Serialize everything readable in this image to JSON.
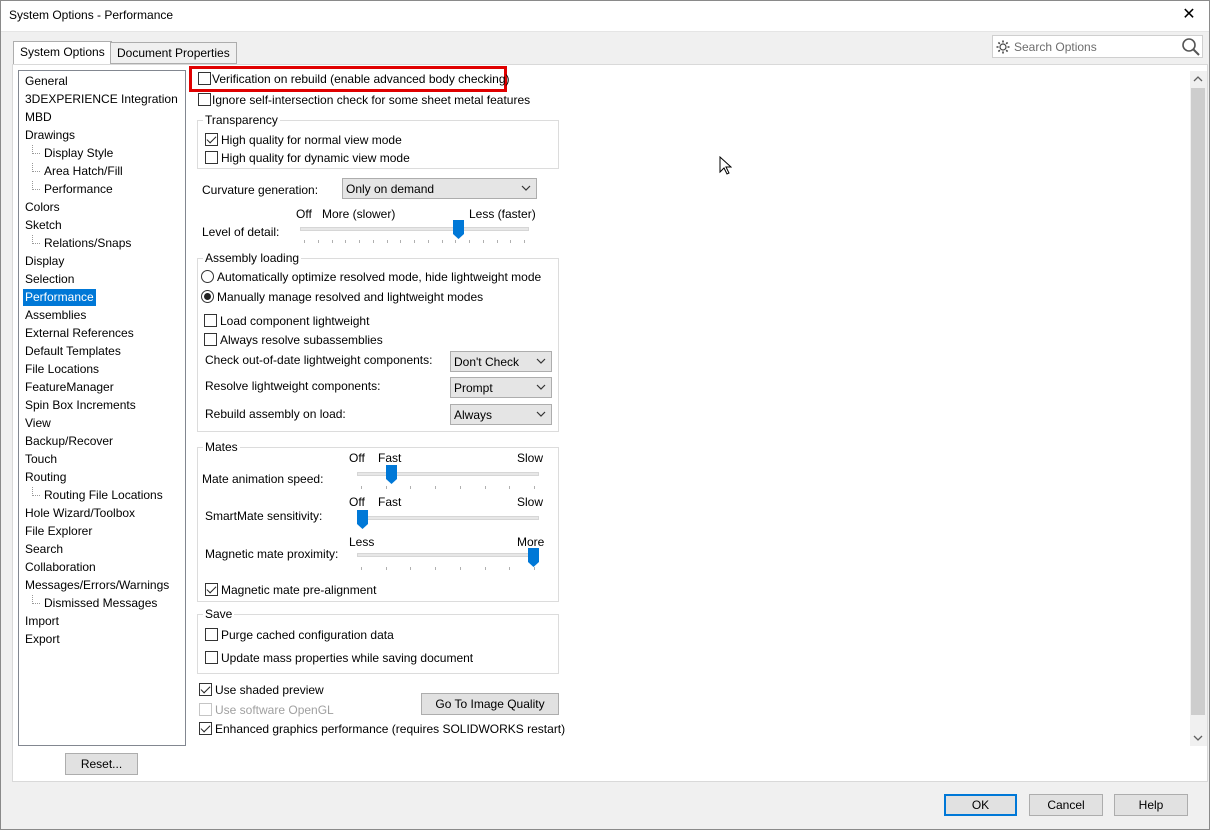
{
  "window": {
    "title": "System Options - Performance",
    "close": "✕"
  },
  "tabs": [
    {
      "label": "System Options"
    },
    {
      "label": "Document Properties"
    }
  ],
  "search": {
    "placeholder": "Search Options"
  },
  "tree": [
    {
      "label": "General"
    },
    {
      "label": "3DEXPERIENCE Integration"
    },
    {
      "label": "MBD"
    },
    {
      "label": "Drawings"
    },
    {
      "label": "Display Style"
    },
    {
      "label": "Area Hatch/Fill"
    },
    {
      "label": "Performance"
    },
    {
      "label": "Colors"
    },
    {
      "label": "Sketch"
    },
    {
      "label": "Relations/Snaps"
    },
    {
      "label": "Display"
    },
    {
      "label": "Selection"
    },
    {
      "label": "Performance"
    },
    {
      "label": "Assemblies"
    },
    {
      "label": "External References"
    },
    {
      "label": "Default Templates"
    },
    {
      "label": "File Locations"
    },
    {
      "label": "FeatureManager"
    },
    {
      "label": "Spin Box Increments"
    },
    {
      "label": "View"
    },
    {
      "label": "Backup/Recover"
    },
    {
      "label": "Touch"
    },
    {
      "label": "Routing"
    },
    {
      "label": "Routing File Locations"
    },
    {
      "label": "Hole Wizard/Toolbox"
    },
    {
      "label": "File Explorer"
    },
    {
      "label": "Search"
    },
    {
      "label": "Collaboration"
    },
    {
      "label": "Messages/Errors/Warnings"
    },
    {
      "label": "Dismissed Messages"
    },
    {
      "label": "Import"
    },
    {
      "label": "Export"
    }
  ],
  "buttons": {
    "reset": "Reset...",
    "go_image_quality": "Go To Image Quality",
    "ok": "OK",
    "cancel": "Cancel",
    "help": "Help"
  },
  "options": {
    "verification": {
      "label": "Verification on rebuild (enable advanced body checking)",
      "checked": false
    },
    "ignore_self_intersection": {
      "label": "Ignore self-intersection check for some sheet metal features",
      "checked": false
    }
  },
  "transparency": {
    "title": "Transparency",
    "normal": {
      "label": "High quality for normal view mode",
      "checked": true
    },
    "dynamic": {
      "label": "High quality for dynamic view mode",
      "checked": false
    }
  },
  "curvature": {
    "label": "Curvature generation:",
    "value": "Only on demand"
  },
  "level_of_detail": {
    "label": "Level of detail:",
    "off": "Off",
    "more": "More (slower)",
    "less": "Less (faster)",
    "position": 0.7
  },
  "assembly": {
    "title": "Assembly loading",
    "radio_auto": {
      "label": "Automatically optimize resolved mode, hide lightweight mode",
      "selected": false
    },
    "radio_manual": {
      "label": "Manually manage resolved and lightweight modes",
      "selected": true
    },
    "load_lightweight": {
      "label": "Load component lightweight",
      "checked": false
    },
    "always_resolve": {
      "label": "Always resolve subassemblies",
      "checked": false
    },
    "check_outdated": {
      "label": "Check out-of-date lightweight components:",
      "value": "Don't Check"
    },
    "resolve_lightweight": {
      "label": "Resolve lightweight components:",
      "value": "Prompt"
    },
    "rebuild_on_load": {
      "label": "Rebuild assembly on load:",
      "value": "Always"
    }
  },
  "mates": {
    "title": "Mates",
    "animation": {
      "label": "Mate animation speed:",
      "off": "Off",
      "fast": "Fast",
      "slow": "Slow",
      "position": 0.14
    },
    "smartmate": {
      "label": "SmartMate sensitivity:",
      "off": "Off",
      "fast": "Fast",
      "slow": "Slow",
      "position": 0.0
    },
    "proximity": {
      "label": "Magnetic mate proximity:",
      "less": "Less",
      "more": "More",
      "position": 1.0
    },
    "prealign": {
      "label": "Magnetic mate pre-alignment",
      "checked": true
    }
  },
  "save": {
    "title": "Save",
    "purge": {
      "label": "Purge cached configuration data",
      "checked": false
    },
    "update_mass": {
      "label": "Update mass properties while saving document",
      "checked": false
    }
  },
  "bottom_options": {
    "shaded_preview": {
      "label": "Use shaded preview",
      "checked": true
    },
    "software_opengl": {
      "label": "Use software OpenGL",
      "checked": false,
      "disabled": true
    },
    "enhanced_graphics": {
      "label": "Enhanced graphics performance (requires SOLIDWORKS restart)",
      "checked": true
    }
  },
  "colors": {
    "accent": "#0078d7",
    "highlight": "#e00000"
  }
}
